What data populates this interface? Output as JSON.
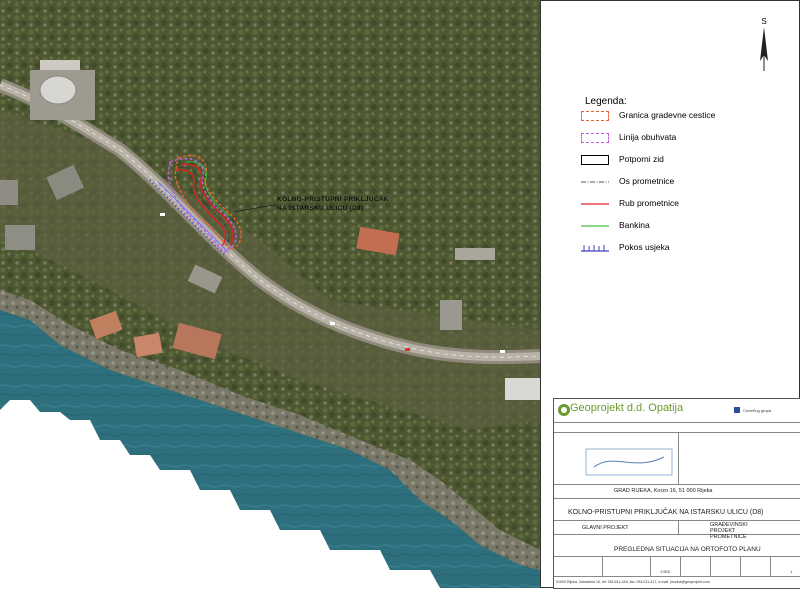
{
  "north_arrow": {
    "label": "S"
  },
  "legend": {
    "title": "Legenda:",
    "items": [
      {
        "label": "Granica gradevne cestice",
        "symbol": "dashed-orange-rect",
        "color": "#e8632c"
      },
      {
        "label": "Linija obuhvata",
        "symbol": "dashed-purple-rect",
        "color": "#c060e0"
      },
      {
        "label": "Potporni zid",
        "symbol": "black-rect",
        "color": "#000000"
      },
      {
        "label": "Os prometnice",
        "symbol": "dash-dot-line",
        "color": "#555555"
      },
      {
        "label": "Rub prometnice",
        "symbol": "red-line",
        "color": "#e02020"
      },
      {
        "label": "Bankina",
        "symbol": "green-line",
        "color": "#40c040"
      },
      {
        "label": "Pokos usjeka",
        "symbol": "hatched-blue-line",
        "color": "#4040c0"
      }
    ]
  },
  "map_label": {
    "line1": "KOLNO-PRISTUPNI PRIKLJUČAK",
    "line2": "NA ISTARSKU ULICU (D8)"
  },
  "title_block": {
    "company": "Geoprojekt d.d. Opatija",
    "group": "ConeEng grupa",
    "investor_value": "GRAD RIJEKA, Korzo 16, 51 000 Rijeka",
    "building_value": "KOLNO-PRISTUPNI PRIKLJUČAK NA ISTARSKU ULICU (D8)",
    "project_type_value": "GLAVNI PROJEKT",
    "project_section_value": "GRAĐEVINSKI PROJEKT PROMETNICE",
    "drawing_value": "PREGLEDNA SITUACIJA NA ORTOFOTO PLANU",
    "scale_value": "1:500",
    "sheet_value": "1",
    "footer": "51000 Rijeka,      Zanatalna 16,      tel: 051/211-418,      fax: 051/211-417,      e-mail: jirovina@geoprojekt.com"
  },
  "colors": {
    "sea": "#2f7180",
    "forest": "#4f5a33",
    "road": "#a09a8c",
    "accent_green": "#6d9a2f"
  }
}
